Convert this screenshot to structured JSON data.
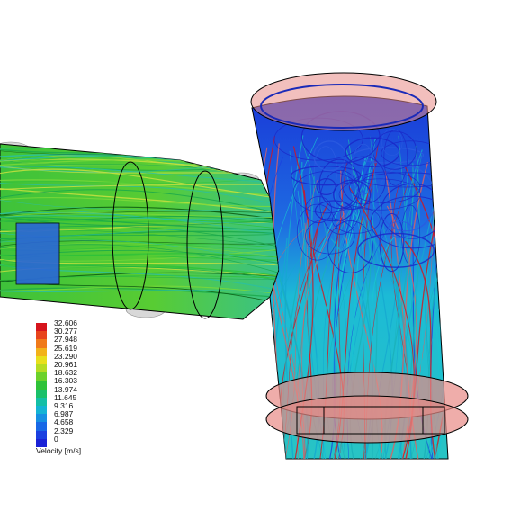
{
  "legend": {
    "title": "Velocity [m/s]",
    "ticks": [
      "32.606",
      "30.277",
      "27.948",
      "25.619",
      "23.290",
      "20.961",
      "18.632",
      "16.303",
      "13.974",
      "11.645",
      "9.316",
      "6.987",
      "4.658",
      "2.329",
      "0"
    ],
    "colors": [
      "#d6141c",
      "#e8441c",
      "#f07a1a",
      "#f2b21a",
      "#e8df1c",
      "#b6dc22",
      "#6cd12a",
      "#2fc238",
      "#1ac06a",
      "#14bfa6",
      "#14b4d4",
      "#1690e2",
      "#1868e6",
      "#1a40e0",
      "#1a22d6"
    ]
  },
  "scene": {
    "subject": "flow-trajectories-pipe-junction",
    "palette": {
      "background": "#ffffff",
      "flange": "#e88a86",
      "pipe_outline": "#000000",
      "low_velocity": "#1a40e0",
      "mid_velocity": "#2fc238",
      "high_velocity": "#d6141c",
      "cyan": "#19c4d2"
    }
  }
}
